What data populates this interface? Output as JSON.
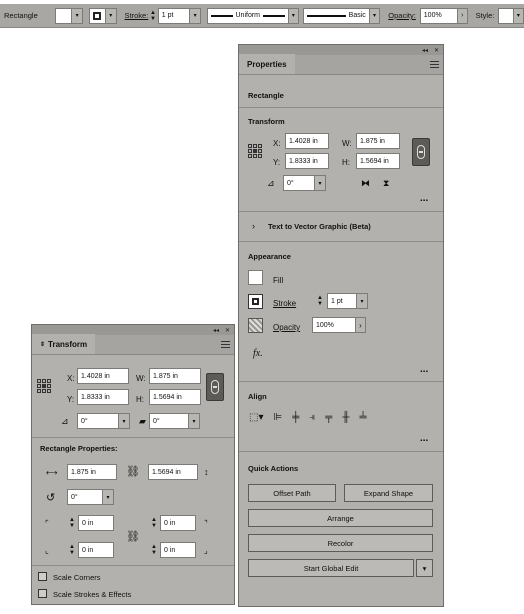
{
  "control_bar": {
    "object_type": "Rectangle",
    "stroke_label": "Stroke:",
    "stroke_weight": "1 pt",
    "profile": "Uniform",
    "brush": "Basic",
    "opacity_label": "Opacity:",
    "opacity_value": "100%",
    "style_label": "Style:"
  },
  "properties": {
    "tab": "Properties",
    "object_type": "Rectangle",
    "transform": {
      "title": "Transform",
      "x_label": "X:",
      "x_value": "1.4028 in",
      "y_label": "Y:",
      "y_value": "1.8333 in",
      "w_label": "W:",
      "w_value": "1.875 in",
      "h_label": "H:",
      "h_value": "1.5694 in",
      "angle_value": "0°"
    },
    "text_to_vector": "Text to Vector Graphic (Beta)",
    "appearance": {
      "title": "Appearance",
      "fill_label": "Fill",
      "stroke_label": "Stroke",
      "stroke_value": "1 pt",
      "opacity_label": "Opacity",
      "opacity_value": "100%",
      "fx_label": "fx."
    },
    "align": {
      "title": "Align"
    },
    "quick_actions": {
      "title": "Quick Actions",
      "offset_path": "Offset Path",
      "expand_shape": "Expand Shape",
      "arrange": "Arrange",
      "recolor": "Recolor",
      "start_global_edit": "Start Global Edit"
    }
  },
  "transform_panel": {
    "tab": "Transform",
    "x_label": "X:",
    "x_value": "1.4028 in",
    "y_label": "Y:",
    "y_value": "1.8333 in",
    "w_label": "W:",
    "w_value": "1.875 in",
    "h_label": "H:",
    "h_value": "1.5694 in",
    "angle_value": "0°",
    "shear_value": "0°",
    "rect_props_title": "Rectangle Properties:",
    "rect_width": "1.875 in",
    "rect_height": "1.5694 in",
    "rect_angle": "0°",
    "corner_tl": "0 in",
    "corner_tr": "0 in",
    "corner_bl": "0 in",
    "corner_br": "0 in",
    "scale_corners": "Scale Corners",
    "scale_strokes": "Scale Strokes & Effects"
  },
  "colors": {
    "panel_bg": "#b3b1ad",
    "bar_bg": "#a9a7a3",
    "lock_bg": "#5d5b58"
  }
}
